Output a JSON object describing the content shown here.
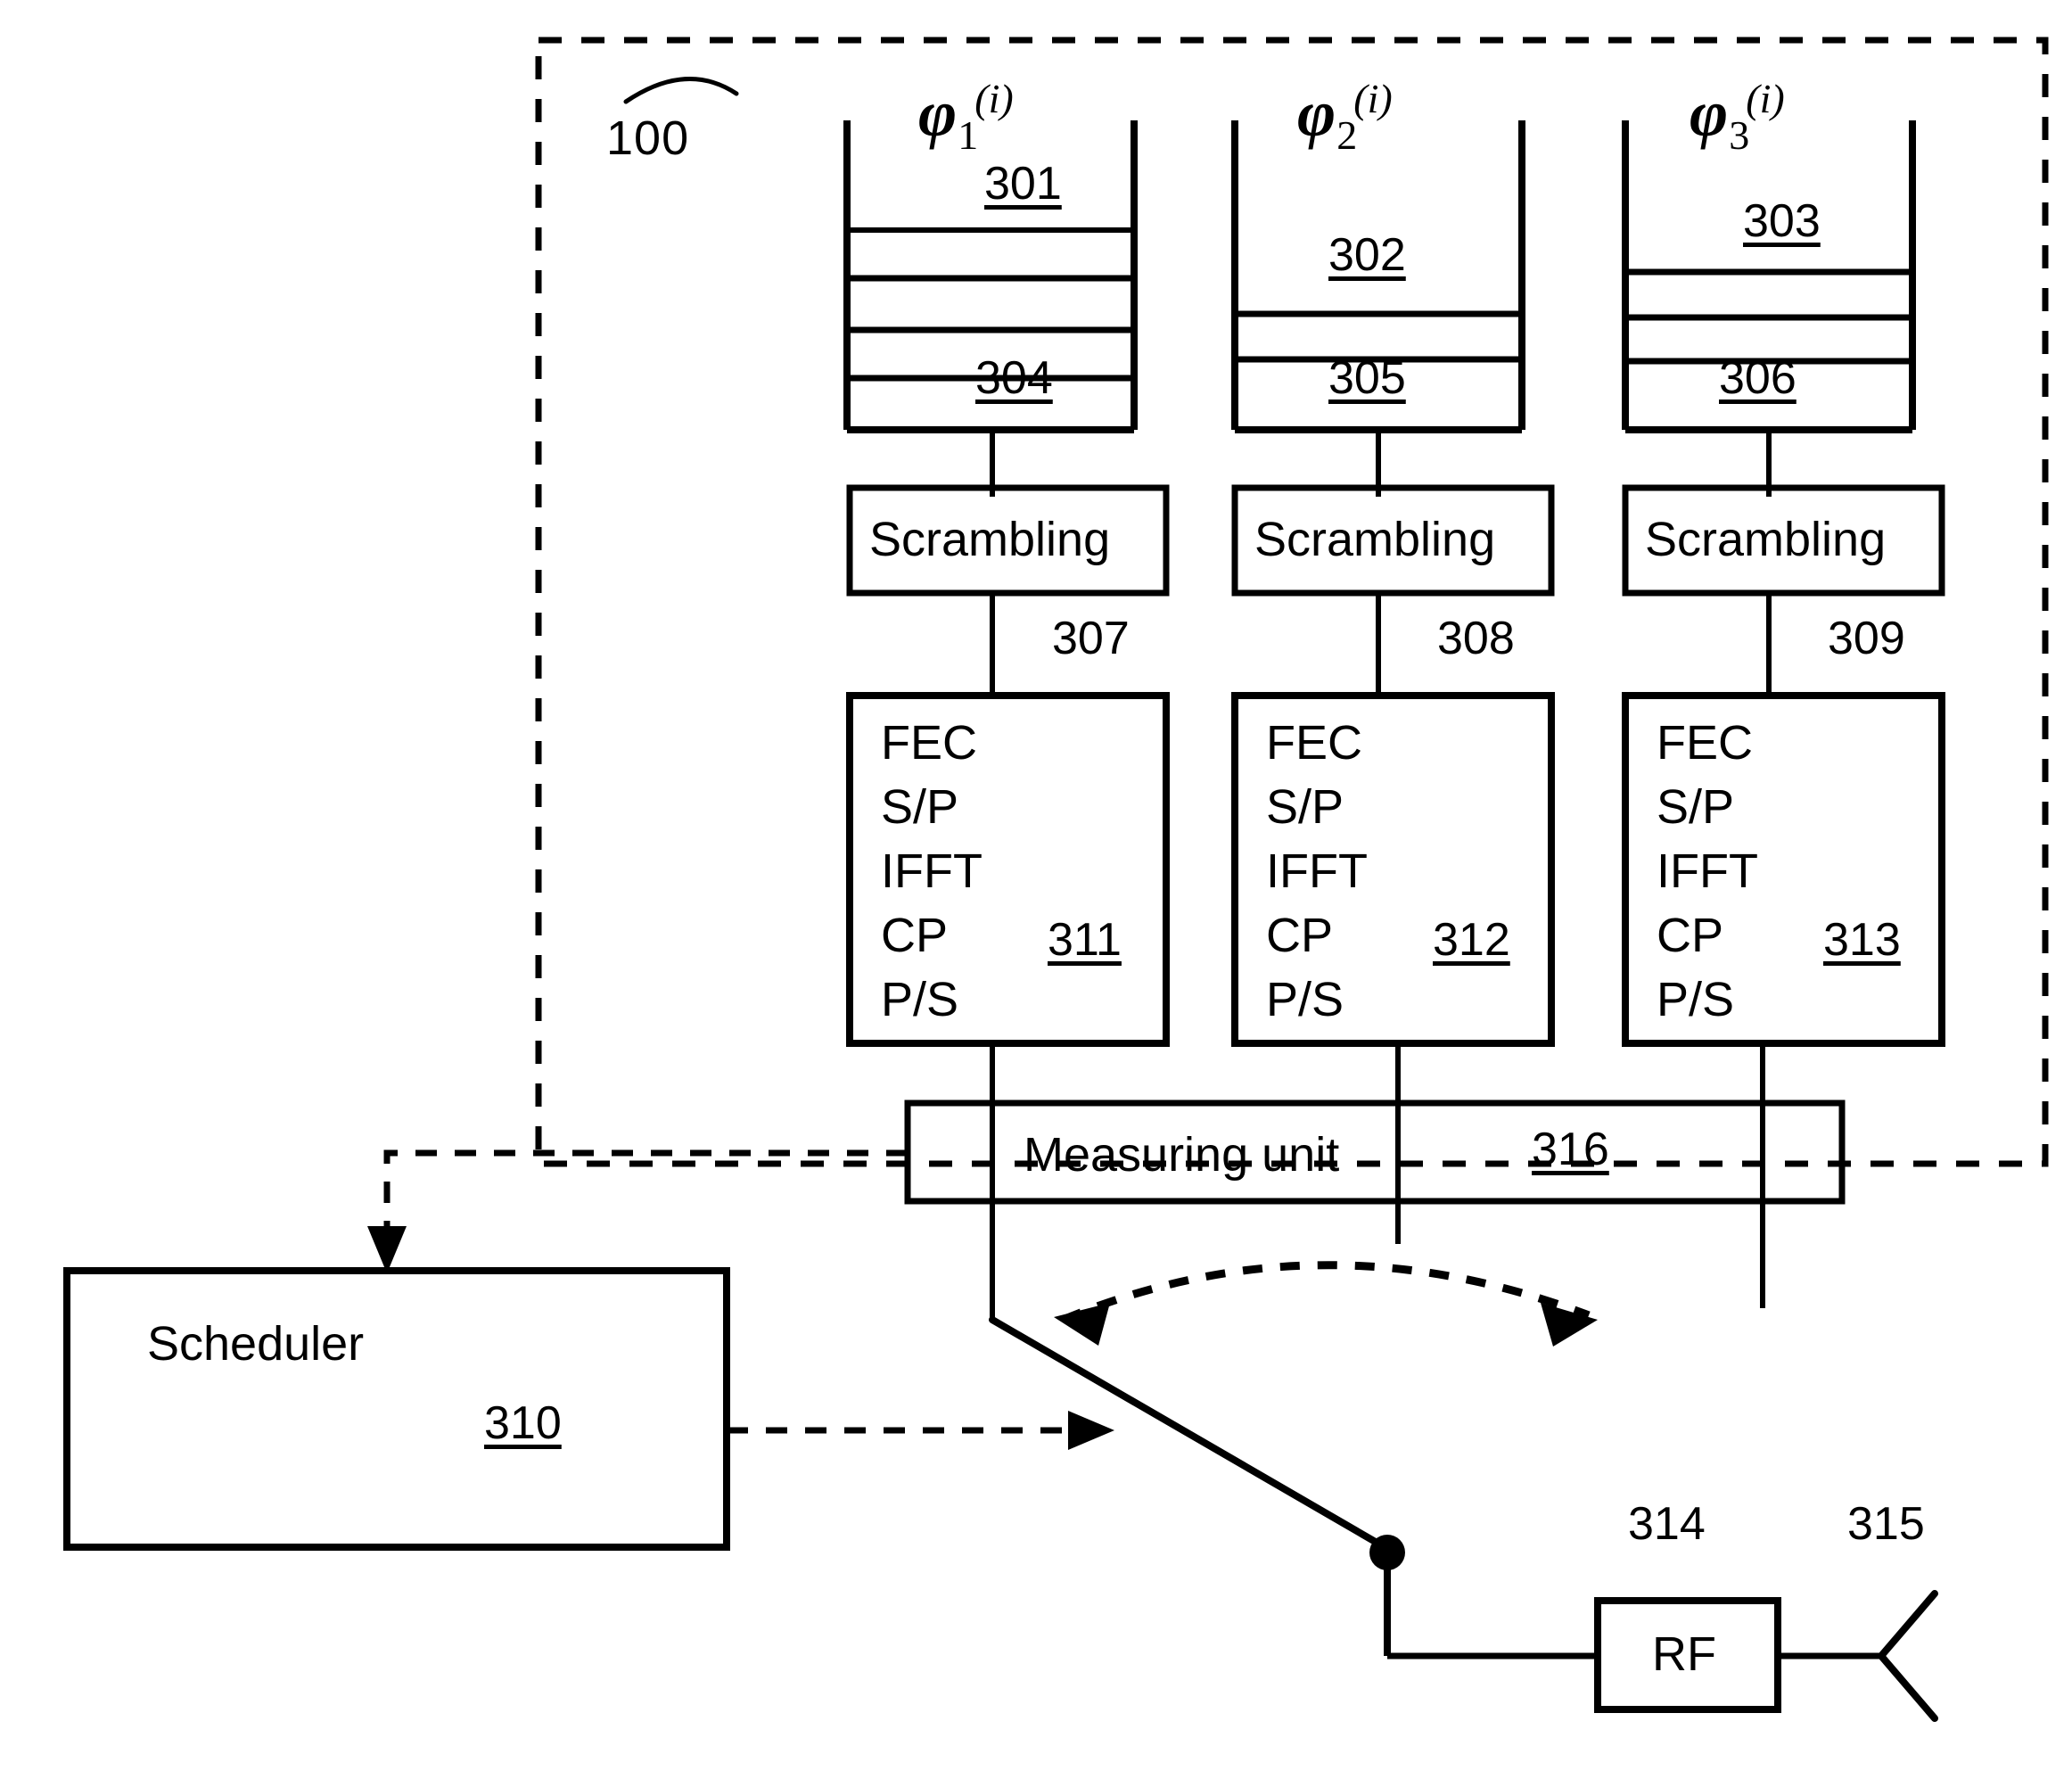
{
  "figure": {
    "system_ref": "100",
    "outer_boundary_style": "dashed"
  },
  "buffers": [
    {
      "signal_label_base": "φ",
      "signal_sub": "1",
      "signal_sup": "(i)",
      "top_ref": "301",
      "bottom_ref": "304",
      "divider_count": 4
    },
    {
      "signal_label_base": "φ",
      "signal_sub": "2",
      "signal_sup": "(i)",
      "top_ref": "302",
      "bottom_ref": "305",
      "divider_count": 2
    },
    {
      "signal_label_base": "φ",
      "signal_sub": "3",
      "signal_sup": "(i)",
      "top_ref": "303",
      "bottom_ref": "306",
      "divider_count": 3
    }
  ],
  "scrambling_blocks": [
    {
      "label": "Scrambling",
      "ref": "307"
    },
    {
      "label": "Scrambling",
      "ref": "308"
    },
    {
      "label": "Scrambling",
      "ref": "309"
    }
  ],
  "processing_blocks": [
    {
      "lines": [
        "FEC",
        "S/P",
        "IFFT",
        "CP",
        "P/S"
      ],
      "ref": "311"
    },
    {
      "lines": [
        "FEC",
        "S/P",
        "IFFT",
        "CP",
        "P/S"
      ],
      "ref": "312"
    },
    {
      "lines": [
        "FEC",
        "S/P",
        "IFFT",
        "CP",
        "P/S"
      ],
      "ref": "313"
    }
  ],
  "processing_text": {
    "l1": "FEC",
    "l2": "S/P",
    "l3": "IFFT",
    "l4": "CP",
    "l5": "P/S"
  },
  "measuring_unit": {
    "label": "Measuring unit",
    "ref": "316"
  },
  "scheduler": {
    "label": "Scheduler",
    "ref": "310"
  },
  "rf": {
    "label": "RF",
    "ref": "314"
  },
  "antenna": {
    "ref": "315"
  },
  "colors": {
    "ink": "#000000",
    "paper": "#ffffff"
  }
}
